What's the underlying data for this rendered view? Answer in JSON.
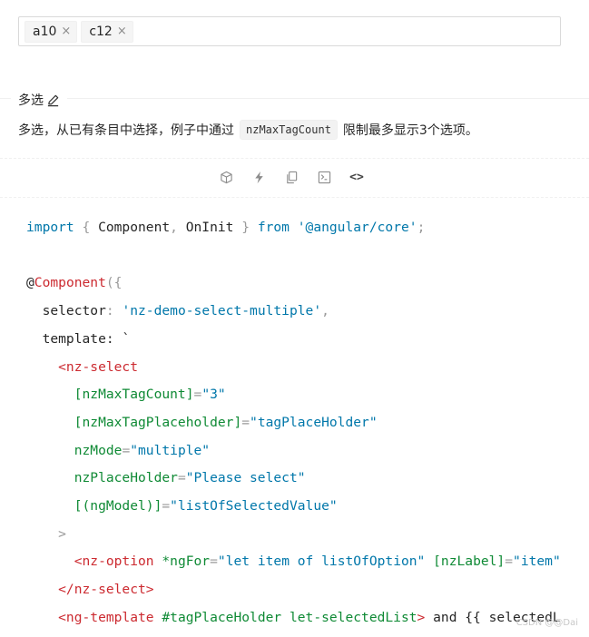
{
  "select": {
    "tags": [
      {
        "label": "a10",
        "remove": "×"
      },
      {
        "label": "c12",
        "remove": "×"
      }
    ]
  },
  "section": {
    "title": "多选",
    "description_before": "多选，从已有条目中选择，例子中通过",
    "code_chip": "nzMaxTagCount",
    "description_after": "限制最多显示3个选项。"
  },
  "actions": {
    "icons": [
      "stackblitz-icon",
      "flash-icon",
      "copy-icon",
      "terminal-icon",
      "code-expand-icon"
    ],
    "code_toggle": "<>"
  },
  "code": {
    "line1": {
      "k1": "import",
      "p1": " { ",
      "t1": "Component",
      "p2": ", ",
      "t2": "OnInit",
      "p3": " } ",
      "k2": "from",
      "s": " '@angular/core'",
      "p4": ";"
    },
    "line3": {
      "at": "@",
      "dec": "Component",
      "p": "({"
    },
    "line4": {
      "prop": "  selector",
      "p": ": ",
      "s": "'nz-demo-select-multiple'",
      "p2": ","
    },
    "line5": {
      "prop": "  template",
      "p": ": `"
    },
    "line6": {
      "tag": "    <nz-select"
    },
    "line7": {
      "attr": "      [nzMaxTagCount]",
      "p": "=",
      "s": "\"3\""
    },
    "line8": {
      "attr": "      [nzMaxTagPlaceholder]",
      "p": "=",
      "s": "\"tagPlaceHolder\""
    },
    "line9": {
      "attr": "      nzMode",
      "p": "=",
      "s": "\"multiple\""
    },
    "line10": {
      "attr": "      nzPlaceHolder",
      "p": "=",
      "s": "\"Please select\""
    },
    "line11": {
      "attr": "      [(ngModel)]",
      "p": "=",
      "s": "\"listOfSelectedValue\""
    },
    "line12": {
      "p": "    >"
    },
    "line13": {
      "tag": "      <nz-option",
      "attr": " *ngFor",
      "p": "=",
      "s": "\"let item of listOfOption\"",
      "attr2": " [nzLabel]",
      "p2": "=",
      "s2": "\"item\""
    },
    "line14": {
      "tag": "    </nz-select>"
    },
    "line15": {
      "tag": "    <ng-template",
      "attr": " #tagPlaceHolder let-selectedList",
      "p": ">",
      "text": " and {{ selectedL"
    }
  },
  "watermark": "CSDN @@Dai"
}
